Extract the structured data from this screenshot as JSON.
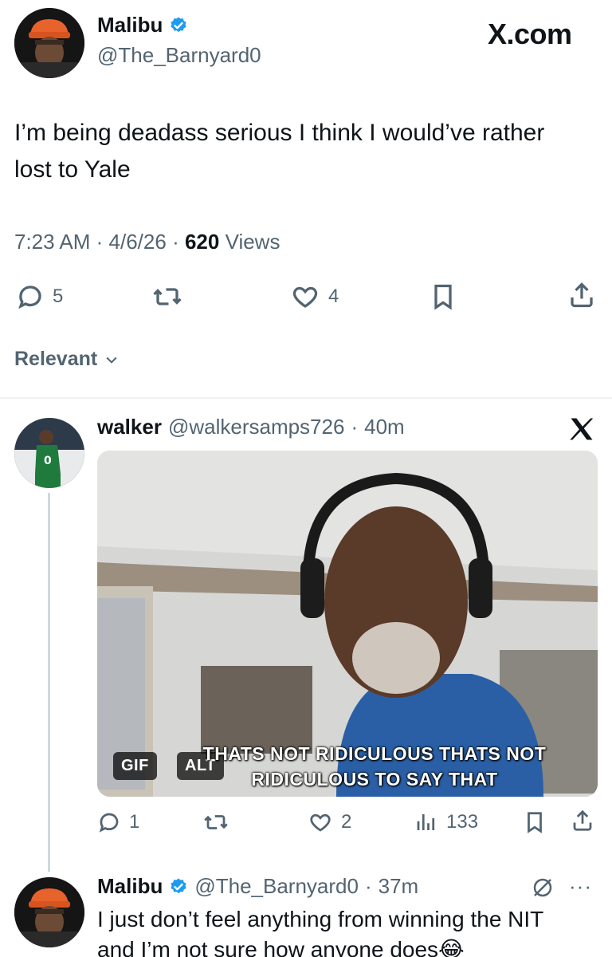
{
  "main_tweet": {
    "author_name": "Malibu",
    "author_handle": "@The_Barnyard0",
    "site_badge": "X.com",
    "text": "I’m being deadass serious I think I would’ve rather lost to Yale",
    "time": "7:23 AM",
    "date": "4/6/26",
    "views_count": "620",
    "views_label": "Views",
    "replies": "5",
    "likes": "4"
  },
  "sort": {
    "label": "Relevant"
  },
  "reply1": {
    "author_name": "walker",
    "author_handle": "@walkersamps726",
    "age": "40m",
    "gif_badge": "GIF",
    "alt_badge": "ALT",
    "caption_line1": "THATS NOT RIDICULOUS THATS NOT",
    "caption_line2": "RIDICULOUS TO SAY THAT",
    "replies": "1",
    "likes": "2",
    "views": "133"
  },
  "reply2": {
    "author_name": "Malibu",
    "author_handle": "@The_Barnyard0",
    "age": "37m",
    "text_line1": "I just don’t feel anything from winning the NIT",
    "text_line2": "and I’m not sure how anyone does😂"
  },
  "colors": {
    "verified": "#1d9bf0",
    "text": "#0f1419",
    "muted": "#536471",
    "divider": "#eff3f4"
  },
  "icons": [
    "verified-icon",
    "reply-icon",
    "retweet-icon",
    "like-icon",
    "bookmark-icon",
    "share-icon",
    "x-logo-icon",
    "views-icon",
    "grok-icon",
    "more-icon",
    "chevron-down-icon"
  ]
}
